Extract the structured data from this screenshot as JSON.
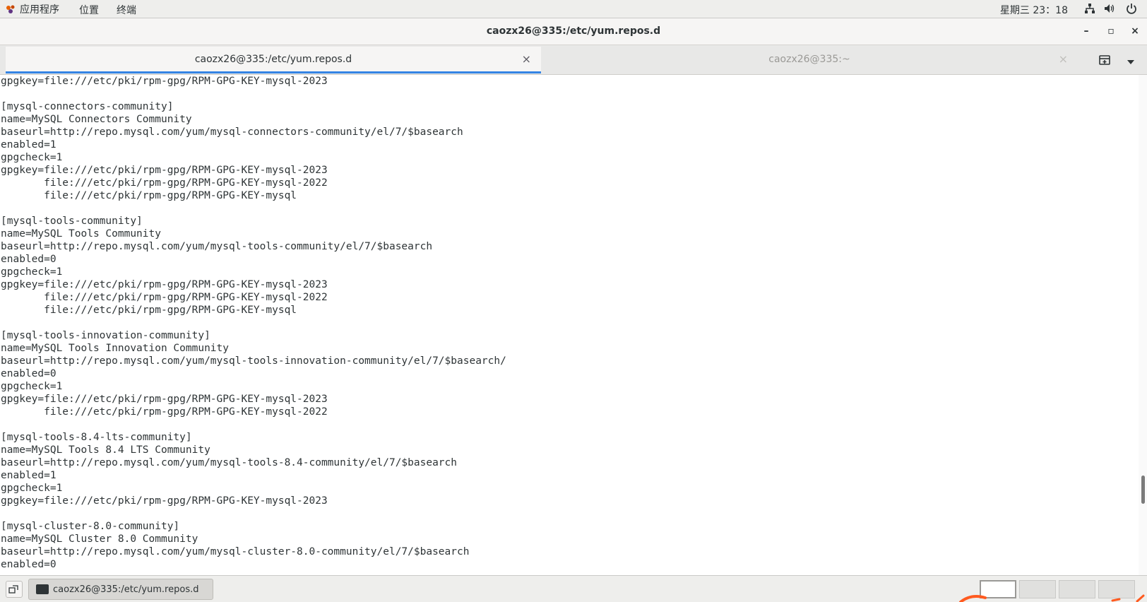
{
  "top_panel": {
    "applications": "应用程序",
    "places": "位置",
    "terminal_menu": "终端",
    "clock": "星期三 23：18",
    "icons": [
      "network-icon",
      "volume-icon",
      "power-icon"
    ]
  },
  "window": {
    "title": "caozx26@335:/etc/yum.repos.d",
    "buttons": {
      "minimize": "–",
      "maximize": "▫",
      "close": "×"
    }
  },
  "tabs": [
    {
      "label": "caozx26@335:/etc/yum.repos.d",
      "close": "×",
      "active": true
    },
    {
      "label": "caozx26@335:~",
      "close": "×",
      "active": false
    }
  ],
  "terminal": {
    "lines": [
      "gpgkey=file:///etc/pki/rpm-gpg/RPM-GPG-KEY-mysql-2023",
      "",
      "[mysql-connectors-community]",
      "name=MySQL Connectors Community",
      "baseurl=http://repo.mysql.com/yum/mysql-connectors-community/el/7/$basearch",
      "enabled=1",
      "gpgcheck=1",
      "gpgkey=file:///etc/pki/rpm-gpg/RPM-GPG-KEY-mysql-2023",
      "       file:///etc/pki/rpm-gpg/RPM-GPG-KEY-mysql-2022",
      "       file:///etc/pki/rpm-gpg/RPM-GPG-KEY-mysql",
      "",
      "[mysql-tools-community]",
      "name=MySQL Tools Community",
      "baseurl=http://repo.mysql.com/yum/mysql-tools-community/el/7/$basearch",
      "enabled=0",
      "gpgcheck=1",
      "gpgkey=file:///etc/pki/rpm-gpg/RPM-GPG-KEY-mysql-2023",
      "       file:///etc/pki/rpm-gpg/RPM-GPG-KEY-mysql-2022",
      "       file:///etc/pki/rpm-gpg/RPM-GPG-KEY-mysql",
      "",
      "[mysql-tools-innovation-community]",
      "name=MySQL Tools Innovation Community",
      "baseurl=http://repo.mysql.com/yum/mysql-tools-innovation-community/el/7/$basearch/",
      "enabled=0",
      "gpgcheck=1",
      "gpgkey=file:///etc/pki/rpm-gpg/RPM-GPG-KEY-mysql-2023",
      "       file:///etc/pki/rpm-gpg/RPM-GPG-KEY-mysql-2022",
      "",
      "[mysql-tools-8.4-lts-community]",
      "name=MySQL Tools 8.4 LTS Community",
      "baseurl=http://repo.mysql.com/yum/mysql-tools-8.4-community/el/7/$basearch",
      "enabled=1",
      "gpgcheck=1",
      "gpgkey=file:///etc/pki/rpm-gpg/RPM-GPG-KEY-mysql-2023",
      "",
      "[mysql-cluster-8.0-community]",
      "name=MySQL Cluster 8.0 Community",
      "baseurl=http://repo.mysql.com/yum/mysql-cluster-8.0-community/el/7/$basearch",
      "enabled=0"
    ]
  },
  "taskbar": {
    "task_label": "caozx26@335:/etc/yum.repos.d",
    "workspaces": 4
  },
  "colors": {
    "tab_accent": "#3584e4",
    "panel_bg": "#eeeeec",
    "text": "#2e3436"
  }
}
